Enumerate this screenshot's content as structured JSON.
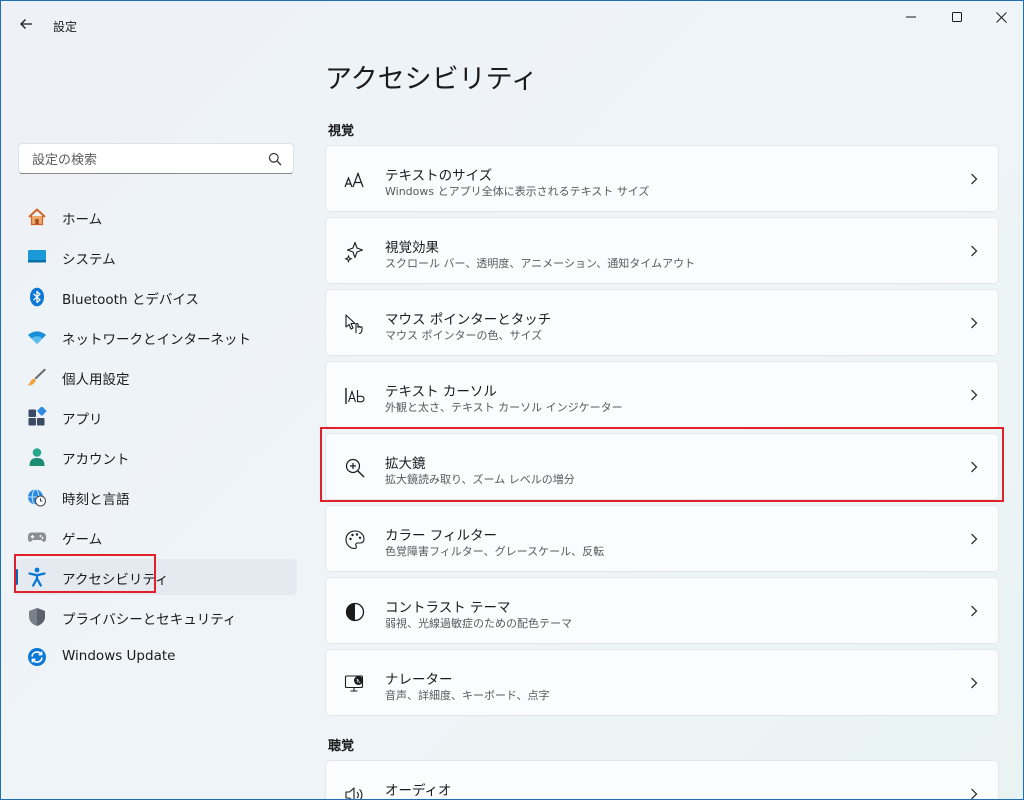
{
  "app": {
    "title": "設定"
  },
  "search": {
    "placeholder": "設定の検索"
  },
  "sidebar": {
    "items": [
      {
        "label": "ホーム",
        "icon": "home-icon"
      },
      {
        "label": "システム",
        "icon": "system-icon"
      },
      {
        "label": "Bluetooth とデバイス",
        "icon": "bluetooth-icon"
      },
      {
        "label": "ネットワークとインターネット",
        "icon": "wifi-icon"
      },
      {
        "label": "個人用設定",
        "icon": "brush-icon"
      },
      {
        "label": "アプリ",
        "icon": "apps-icon"
      },
      {
        "label": "アカウント",
        "icon": "account-icon"
      },
      {
        "label": "時刻と言語",
        "icon": "clock-globe-icon"
      },
      {
        "label": "ゲーム",
        "icon": "gamepad-icon"
      },
      {
        "label": "アクセシビリティ",
        "icon": "accessibility-icon",
        "active": true
      },
      {
        "label": "プライバシーとセキュリティ",
        "icon": "shield-icon"
      },
      {
        "label": "Windows Update",
        "icon": "update-icon"
      }
    ]
  },
  "main": {
    "title": "アクセシビリティ",
    "sections": [
      {
        "heading": "視覚",
        "cards": [
          {
            "title": "テキストのサイズ",
            "subtitle": "Windows とアプリ全体に表示されるテキスト サイズ",
            "icon": "text-size-icon"
          },
          {
            "title": "視覚効果",
            "subtitle": "スクロール バー、透明度、アニメーション、通知タイムアウト",
            "icon": "visual-effects-icon"
          },
          {
            "title": "マウス ポインターとタッチ",
            "subtitle": "マウス ポインターの色、サイズ",
            "icon": "pointer-touch-icon"
          },
          {
            "title": "テキスト カーソル",
            "subtitle": "外観と太さ、テキスト カーソル インジケーター",
            "icon": "text-cursor-icon"
          },
          {
            "title": "拡大鏡",
            "subtitle": "拡大鏡読み取り、ズーム レベルの増分",
            "icon": "magnifier-icon",
            "highlighted": true
          },
          {
            "title": "カラー フィルター",
            "subtitle": "色覚障害フィルター、グレースケール、反転",
            "icon": "color-palette-icon"
          },
          {
            "title": "コントラスト テーマ",
            "subtitle": "弱視、光線過敏症のための配色テーマ",
            "icon": "contrast-icon"
          },
          {
            "title": "ナレーター",
            "subtitle": "音声、詳細度、キーボード、点字",
            "icon": "narrator-icon"
          }
        ]
      },
      {
        "heading": "聴覚",
        "cards": [
          {
            "title": "オーディオ",
            "subtitle": "",
            "icon": "speaker-icon"
          }
        ]
      }
    ]
  },
  "colors": {
    "accent": "#0067c0",
    "highlight": "#e0202a"
  }
}
